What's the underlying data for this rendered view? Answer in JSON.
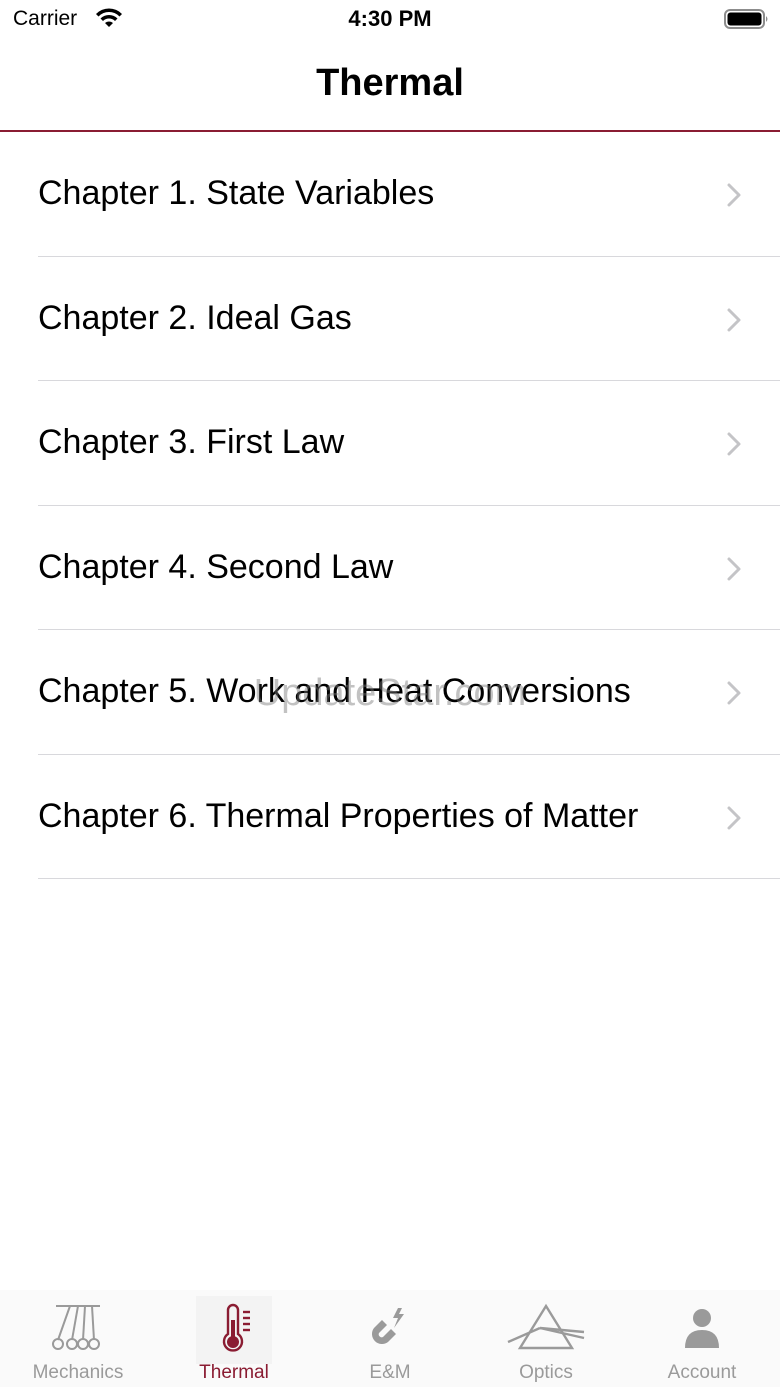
{
  "status_bar": {
    "carrier": "Carrier",
    "time": "4:30 PM"
  },
  "nav": {
    "title": "Thermal"
  },
  "chapters": [
    {
      "label": "Chapter 1. State Variables"
    },
    {
      "label": "Chapter 2. Ideal Gas"
    },
    {
      "label": "Chapter 3. First Law"
    },
    {
      "label": "Chapter 4. Second Law"
    },
    {
      "label": "Chapter 5. Work and Heat Conversions"
    },
    {
      "label": "Chapter 6. Thermal Properties of Matter"
    }
  ],
  "watermark": "UpdateStar.com",
  "tabs": [
    {
      "label": "Mechanics",
      "icon": "pendulum-icon"
    },
    {
      "label": "Thermal",
      "icon": "thermometer-icon",
      "active": true
    },
    {
      "label": "E&M",
      "icon": "magnet-icon"
    },
    {
      "label": "Optics",
      "icon": "prism-icon"
    },
    {
      "label": "Account",
      "icon": "person-icon"
    }
  ],
  "colors": {
    "accent": "#8a1c32",
    "inactive_tab": "#9a9a9a",
    "separator": "#d8d8dc"
  }
}
